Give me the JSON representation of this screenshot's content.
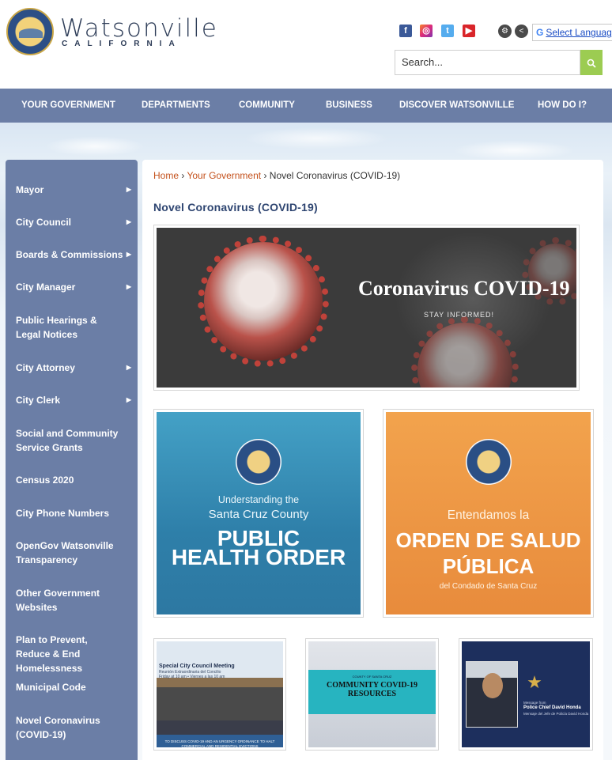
{
  "header": {
    "logo_name": "Watsonville",
    "logo_sub": "CALIFORNIA",
    "social": {
      "facebook": "f",
      "instagram": "◎",
      "twitter": "t",
      "youtube": "▶"
    },
    "translate_g": "G",
    "translate_label": "Select Languag",
    "search_placeholder": "Search..."
  },
  "nav": {
    "items": [
      "YOUR GOVERNMENT",
      "DEPARTMENTS",
      "COMMUNITY",
      "BUSINESS",
      "DISCOVER WATSONVILLE",
      "HOW DO I?"
    ]
  },
  "sidebar": {
    "items": [
      {
        "label": "Mayor",
        "arrow": true
      },
      {
        "label": "City Council",
        "arrow": true
      },
      {
        "label": "Boards & Commissions",
        "arrow": true
      },
      {
        "label": "City Manager",
        "arrow": true
      },
      {
        "label": "Public Hearings & Legal Notices",
        "arrow": false
      },
      {
        "label": "City Attorney",
        "arrow": true
      },
      {
        "label": "City Clerk",
        "arrow": true
      },
      {
        "label": "Social and Community Service Grants",
        "arrow": false
      },
      {
        "label": "Census 2020",
        "arrow": false
      },
      {
        "label": "City Phone Numbers",
        "arrow": false
      },
      {
        "label": "OpenGov Watsonville Transparency",
        "arrow": false
      },
      {
        "label": "Other Government Websites",
        "arrow": false
      },
      {
        "label": "Plan to Prevent, Reduce & End Homelessness",
        "arrow": false
      },
      {
        "label": "Municipal Code",
        "arrow": false
      },
      {
        "label": "Novel Coronavirus (COVID-19)",
        "arrow": false
      }
    ]
  },
  "breadcrumb": {
    "home": "Home",
    "sep": "›",
    "parent": "Your Government",
    "current": "Novel Coronavirus (COVID-19)"
  },
  "page_title": "Novel Coronavirus (COVID-19)",
  "hero": {
    "title": "Coronavirus COVID-19",
    "subtitle": "STAY INFORMED!"
  },
  "card_en": {
    "line1": "Understanding the",
    "line2": "Santa Cruz County",
    "big1": "PUBLIC",
    "big2": "HEALTH ORDER"
  },
  "card_es": {
    "line1": "Entendamos la",
    "big1": "ORDEN DE SALUD",
    "big2": "PÚBLICA",
    "line3": "del Condado de Santa Cruz"
  },
  "card_meeting": {
    "title": "Special City Council Meeting",
    "subtitle": "Reunión Extraordinaria del Concilio",
    "date": "Friday at 10 am • Viernes a las 10 am",
    "caption": "TO DISCUSS COVID-19 AND AN URGENCY ORDINANCE TO HALT COMMERCIAL AND RESIDENTIAL EVICTIONS"
  },
  "card_resources": {
    "small": "COUNTY OF SANTA CRUZ",
    "title": "COMMUNITY COVID-19 RESOURCES"
  },
  "card_police": {
    "small": "Message from",
    "name": "Police Chief David Honda",
    "sub": "Mensaje del Jefe de Policía David Honda"
  }
}
